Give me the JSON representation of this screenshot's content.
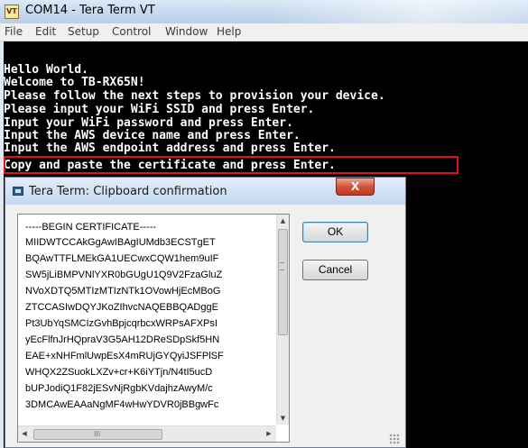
{
  "main_window": {
    "title": "COM14 - Tera Term VT",
    "icon_name": "teraterm-app-icon",
    "menu": [
      "File",
      "Edit",
      "Setup",
      "Control",
      "Window",
      "Help"
    ],
    "terminal_lines": [
      "Hello World.",
      "Welcome to TB-RX65N!",
      "Please follow the next steps to provision your device.",
      "Please input your WiFi SSID and press Enter.",
      "Input your WiFi password and press Enter.",
      "Input the AWS device name and press Enter.",
      "Input the AWS endpoint address and press Enter.",
      "Copy and paste the certificate and press Enter."
    ],
    "highlight_color": "#e01020"
  },
  "dialog": {
    "title": "Tera Term: Clipboard confirmation",
    "close_label": "X",
    "certificate_lines": [
      "-----BEGIN CERTIFICATE-----",
      "MIIDWTCCAkGgAwIBAgIUMdb3ECSTgET",
      "BQAwTTFLMEkGA1UECwxCQW1hem9uIF",
      "SW5jLiBMPVNlYXR0bGUgU1Q9V2FzaGluZ",
      "NVoXDTQ5MTIzMTIzNTk1OVowHjEcMBoG",
      "ZTCCASIwDQYJKoZIhvcNAQEBBQADggE",
      "Pt3UbYqSMCIzGvhBpjcqrbcxWRPsAFXPsI",
      "yEcFlfnJrHQpraV3G5AH12DReSDpSkf5HN",
      "EAE+xNHFmlUwpEsX4mRUjGYQyiJSFPlSF",
      "WHQX2ZSuokLXZv+cr+K6iYTjn/N4tI5ucD",
      "bUPJodiQ1F82jESvNjRgbKVdajhzAwyM/c",
      "3DMCAwEAAaNgMF4wHwYDVR0jBBgwFc"
    ],
    "ok_label": "OK",
    "cancel_label": "Cancel",
    "hscroll_grip": "III"
  }
}
